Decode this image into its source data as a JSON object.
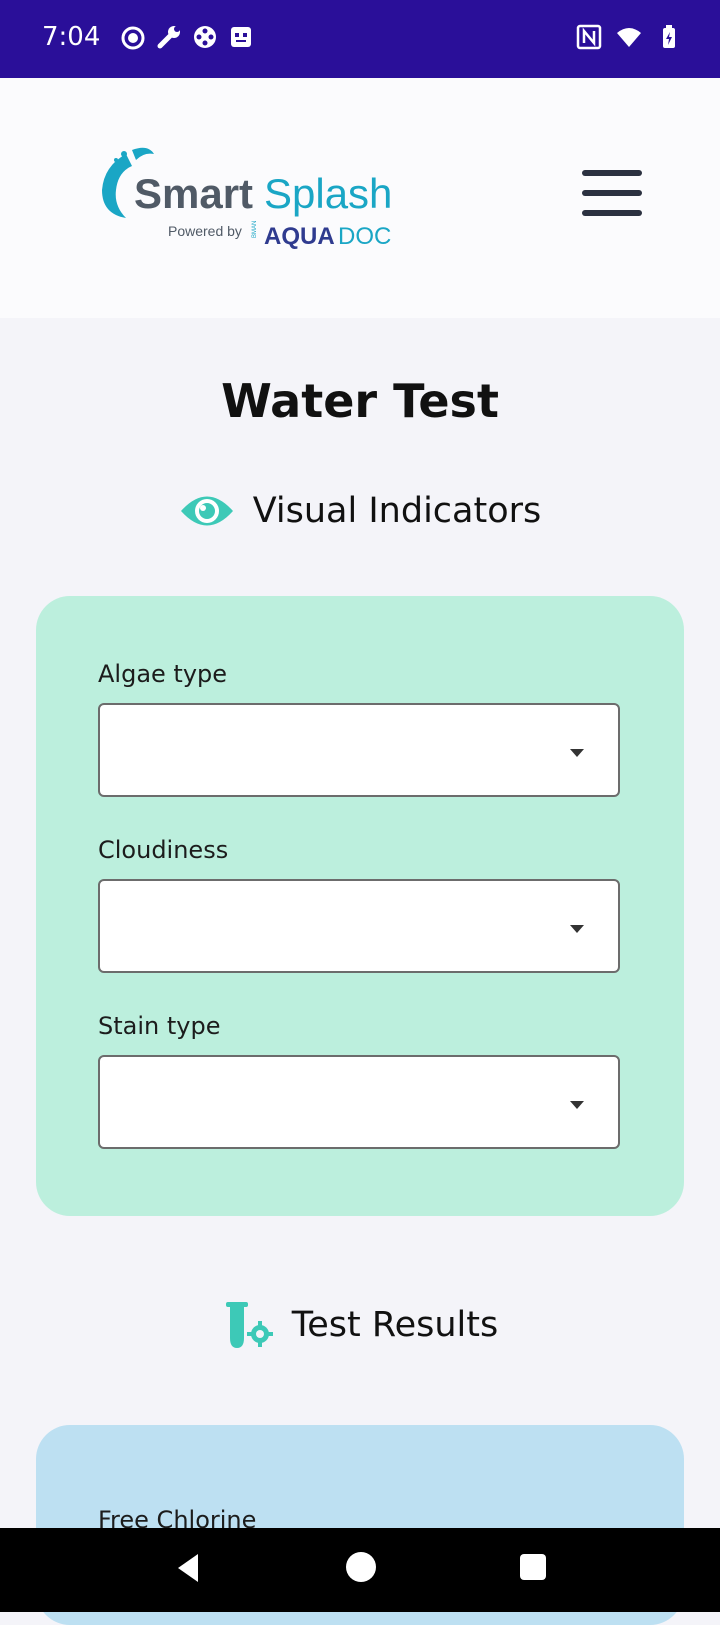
{
  "status_bar": {
    "time": "7:04",
    "left_icons": [
      "cat-face-icon",
      "wrench-icon",
      "gamepad-icon",
      "robot-icon"
    ],
    "right_icons": [
      "nfc-icon",
      "wifi-icon",
      "battery-charging-icon"
    ]
  },
  "header": {
    "logo": {
      "brand": "SmartSplash",
      "tagline_prefix": "Powered by",
      "partner_small": "BMAN",
      "partner_bold": "AQUA",
      "partner_light": "DOC"
    },
    "menu_icon": "hamburger-menu-icon"
  },
  "page": {
    "title": "Water Test"
  },
  "visual_indicators": {
    "heading": "Visual Indicators",
    "icon": "eye-icon",
    "fields": [
      {
        "label": "Algae type",
        "value": ""
      },
      {
        "label": "Cloudiness",
        "value": ""
      },
      {
        "label": "Stain type",
        "value": ""
      }
    ]
  },
  "test_results": {
    "heading": "Test Results",
    "icon": "test-tube-gear-icon",
    "first_field_label": "Free Chlorine"
  },
  "colors": {
    "status_bar": "#2a0f99",
    "visual_card": "#bcefdd",
    "results_card": "#bde0f2",
    "accent_teal": "#3dc9b7",
    "logo_blue": "#1aa6c5"
  },
  "nav_bar": {
    "icons": [
      "back-icon",
      "home-icon",
      "recents-icon"
    ]
  }
}
